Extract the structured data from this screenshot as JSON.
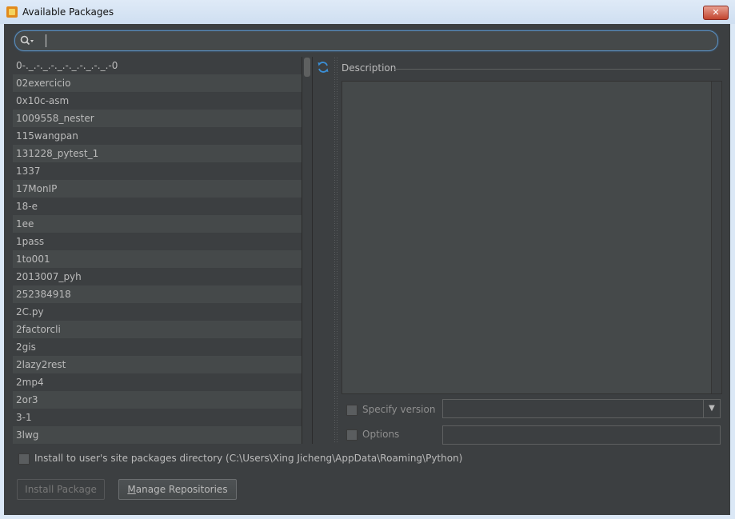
{
  "window": {
    "title": "Available Packages",
    "close_glyph": "✕"
  },
  "search": {
    "value": "",
    "placeholder": ""
  },
  "packages": [
    "0-._.-._.-._.-._.-._.-._.-0",
    "02exercicio",
    "0x10c-asm",
    "1009558_nester",
    "115wangpan",
    "131228_pytest_1",
    "1337",
    "17MonIP",
    "18-e",
    "1ee",
    "1pass",
    "1to001",
    "2013007_pyh",
    "252384918",
    "2C.py",
    "2factorcli",
    "2gis",
    "2lazy2rest",
    "2mp4",
    "2or3",
    "3-1",
    "3lwg"
  ],
  "details": {
    "description_label": "Description",
    "specify_version_label": "Specify version",
    "version_value": "",
    "options_label": "Options",
    "options_value": ""
  },
  "install_option": {
    "label": "Install to user's site packages directory (C:\\Users\\Xing Jicheng\\AppData\\Roaming\\Python)"
  },
  "buttons": {
    "install_label": "Install Package",
    "manage_mnemonic": "M",
    "manage_rest": "anage Repositories"
  },
  "colors": {
    "background": "#3c3f41",
    "row_alt": "#45494a",
    "text": "#bbbbbb",
    "accent": "#5b8fbf",
    "refresh_icon": "#3b8fd6"
  }
}
